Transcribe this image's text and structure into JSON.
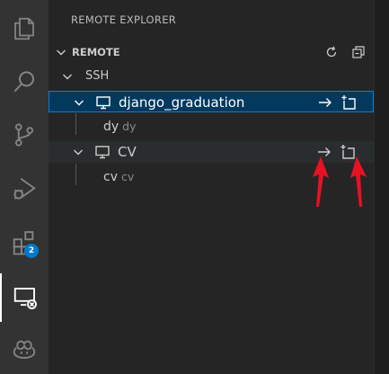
{
  "activity_bar": {
    "items": [
      {
        "name": "explorer-icon"
      },
      {
        "name": "search-icon"
      },
      {
        "name": "source-control-icon"
      },
      {
        "name": "run-debug-icon"
      },
      {
        "name": "extensions-icon",
        "badge": "2"
      },
      {
        "name": "remote-explorer-icon",
        "active": true
      },
      {
        "name": "github-copilot-icon"
      }
    ],
    "badge_color": "#007acc"
  },
  "sidebar": {
    "title": "REMOTE EXPLORER",
    "section": {
      "title": "REMOTE",
      "actions": [
        {
          "name": "refresh-icon"
        },
        {
          "name": "collapse-all-icon"
        }
      ]
    },
    "tree": {
      "group": "SSH",
      "hosts": [
        {
          "label": "django_graduation",
          "selected": true,
          "children": [
            {
              "label": "dy",
              "description": "dy"
            }
          ]
        },
        {
          "label": "CV",
          "selected": false,
          "children": [
            {
              "label": "cv",
              "description": "cv"
            }
          ]
        }
      ]
    }
  },
  "annotations": {
    "arrow_color": "#e81123",
    "targets": [
      "connect-current-window-icon",
      "connect-new-window-icon"
    ]
  },
  "colors": {
    "selection_bg": "#04395e",
    "selection_border": "#007fd4",
    "sidebar_bg": "#252526",
    "activity_bg": "#333333"
  }
}
